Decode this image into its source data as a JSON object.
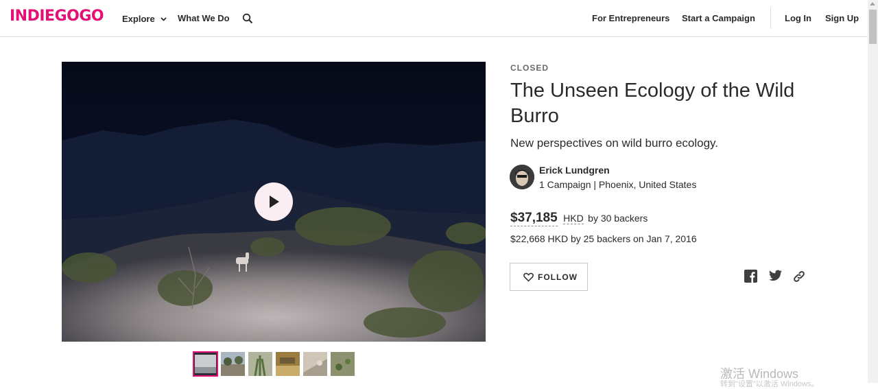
{
  "header": {
    "logo": "INDIEGOGO",
    "nav": {
      "explore": "Explore",
      "what_we_do": "What We Do",
      "for_entrepreneurs": "For Entrepreneurs",
      "start_campaign": "Start a Campaign",
      "login": "Log In",
      "signup": "Sign Up"
    },
    "icons": [
      "chevron-down-icon",
      "search-icon"
    ]
  },
  "campaign": {
    "status": "CLOSED",
    "title": "The Unseen Ecology of the Wild Burro",
    "tagline": "New perspectives on wild burro ecology.",
    "owner": {
      "name": "Erick Lundgren",
      "meta": "1 Campaign | Phoenix, United States"
    },
    "funding": {
      "amount": "$37,185",
      "currency": "HKD",
      "backers_text": "by 30 backers",
      "prior": "$22,668 HKD by 25 backers on Jan 7, 2016"
    },
    "follow_label": "FOLLOW",
    "share_icons": [
      "facebook-icon",
      "twitter-icon",
      "link-icon"
    ]
  },
  "media": {
    "thumbnail_count": 6,
    "active_thumbnail": 0
  },
  "os_watermark": {
    "main": "激活 Windows",
    "sub": "转到\"设置\"以激活 Windows。"
  },
  "colors": {
    "brand": "#e51075",
    "text": "#2a2a2a",
    "muted": "#6a6a6a",
    "border": "#dedede"
  }
}
